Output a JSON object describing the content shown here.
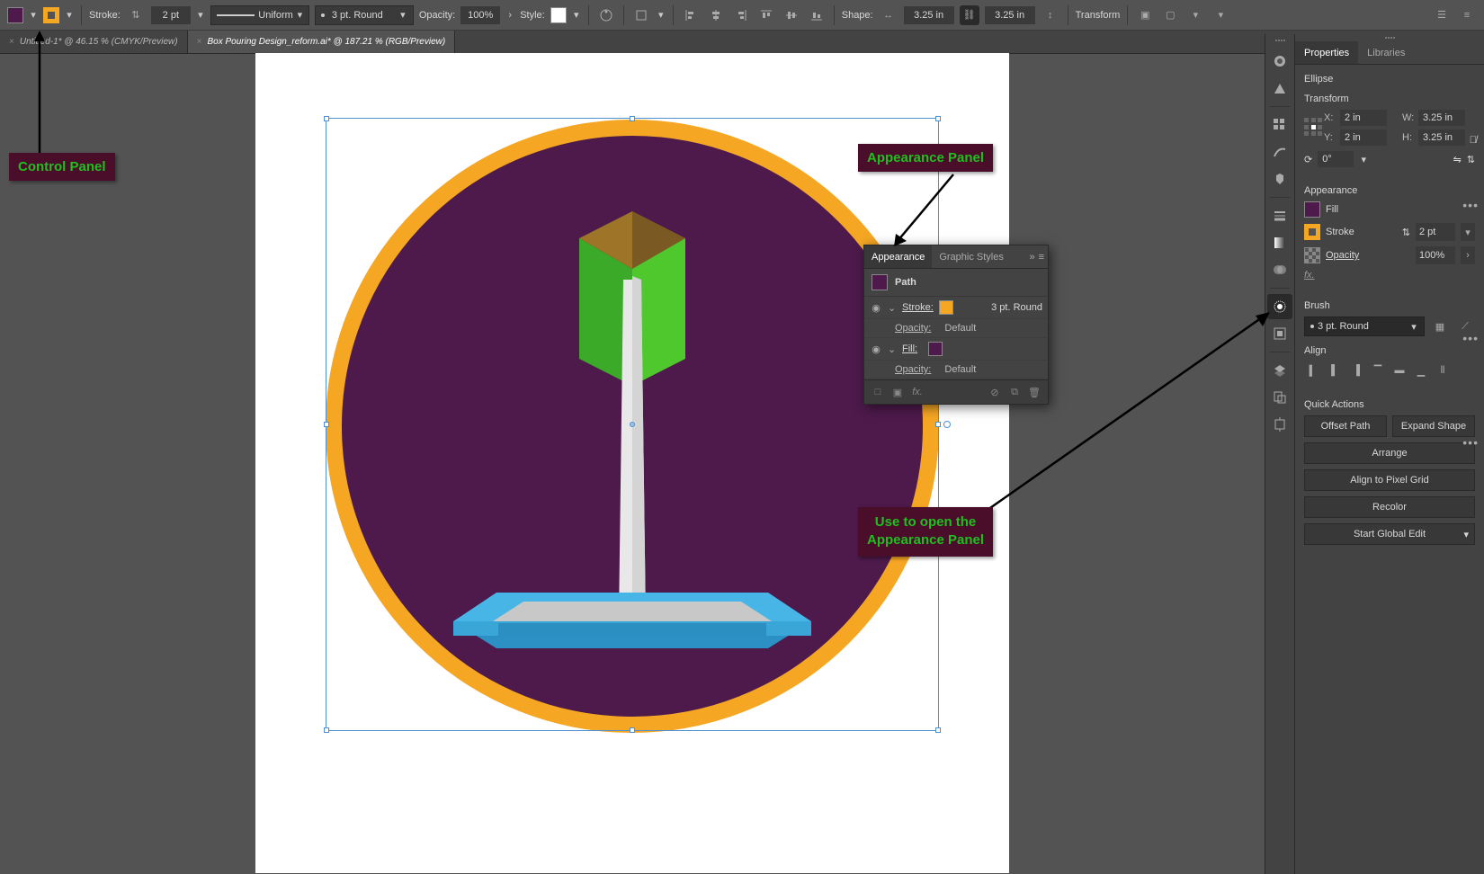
{
  "control_bar": {
    "stroke_label": "Stroke:",
    "stroke_weight": "2 pt",
    "stroke_profile": "Uniform",
    "brush": "3 pt. Round",
    "opacity_label": "Opacity:",
    "opacity_value": "100%",
    "style_label": "Style:",
    "shape_label": "Shape:",
    "shape_w": "3.25 in",
    "shape_h": "3.25 in",
    "transform_label": "Transform",
    "fill_color": "#4d1a4b",
    "stroke_color": "#f5a623"
  },
  "tabs": [
    {
      "label": "Untitled-1* @ 46.15 % (CMYK/Preview)",
      "active": false
    },
    {
      "label": "Box Pouring Design_reform.ai* @ 187.21 % (RGB/Preview)",
      "active": true
    }
  ],
  "annotations": {
    "control_panel": "Control  Panel",
    "appearance_panel": "Appearance Panel",
    "open_appearance": "Use to open the\nAppearance Panel"
  },
  "float_appearance": {
    "tab1": "Appearance",
    "tab2": "Graphic Styles",
    "header": "Path",
    "stroke_label": "Stroke:",
    "stroke_info": "3 pt. Round",
    "opacity_label": "Opacity:",
    "opacity_default": "Default",
    "fill_label": "Fill:",
    "fill_color": "#4d1a4b",
    "stroke_color": "#f5a623"
  },
  "properties": {
    "tab1": "Properties",
    "tab2": "Libraries",
    "sel_type": "Ellipse",
    "transform_head": "Transform",
    "x": "2 in",
    "y": "2 in",
    "w": "3.25 in",
    "h": "3.25 in",
    "angle": "0°",
    "appearance_head": "Appearance",
    "fill_label": "Fill",
    "stroke_label": "Stroke",
    "stroke_weight": "2 pt",
    "opacity_label": "Opacity",
    "opacity_value": "100%",
    "fx_label": "fx.",
    "brush_head": "Brush",
    "brush_value": "3 pt. Round",
    "align_head": "Align",
    "qa_head": "Quick Actions",
    "qa_offset": "Offset Path",
    "qa_expand": "Expand Shape",
    "qa_arrange": "Arrange",
    "qa_pixelgrid": "Align to Pixel Grid",
    "qa_recolor": "Recolor",
    "qa_globaledit": "Start Global Edit"
  }
}
